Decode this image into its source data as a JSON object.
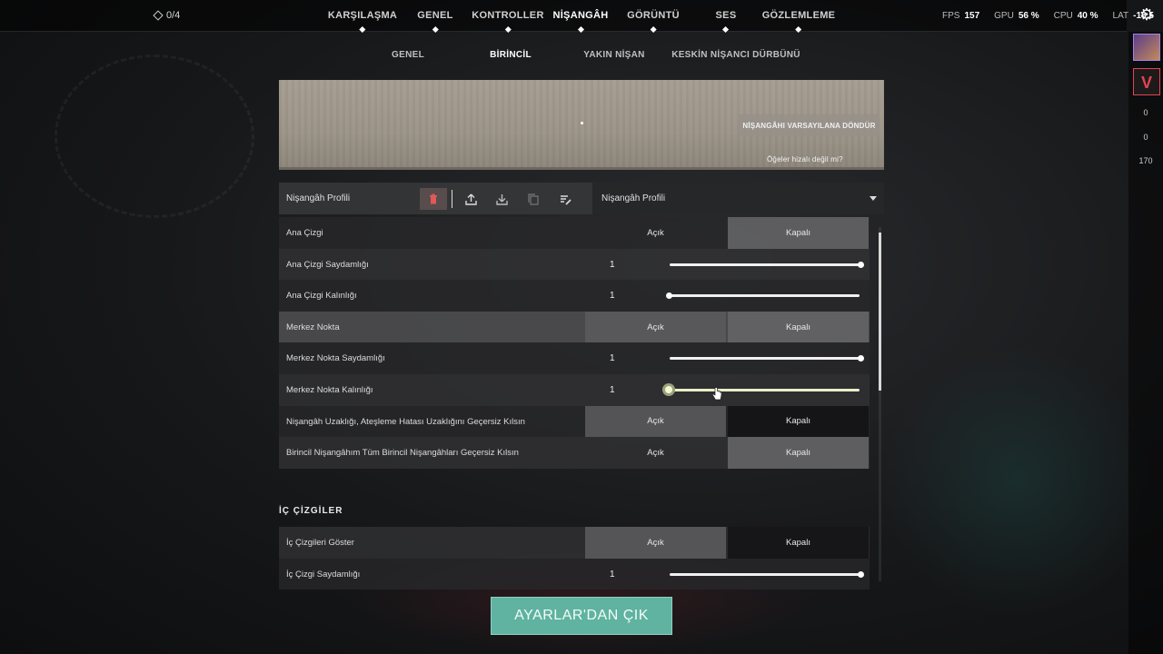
{
  "topbar": {
    "counter": "0/4",
    "tabs": [
      "KARŞILAŞMA",
      "GENEL",
      "KONTROLLER",
      "NİŞANGÂH",
      "GÖRÜNTÜ",
      "SES",
      "GÖZLEMLEME"
    ],
    "active_tab": "NİŞANGÂH",
    "perf": {
      "fps_label": "FPS",
      "fps": "157",
      "gpu_label": "GPU",
      "gpu": "56 %",
      "cpu_label": "CPU",
      "cpu": "40 %",
      "lat_label": "LAT",
      "lat": "-18.5"
    }
  },
  "rail": {
    "nums": [
      "0",
      "0",
      "170"
    ]
  },
  "subtabs": [
    "GENEL",
    "BİRİNCİL",
    "YAKIN NİŞAN",
    "KESKİN NİŞANCI DÜRBÜNÜ"
  ],
  "active_subtab": "BİRİNCİL",
  "preview": {
    "reset_label": "NİŞANGÂHI VARSAYILANA DÖNDÜR",
    "misaligned_label": "Öğeler hizalı değil mi?"
  },
  "profile": {
    "label": "Nişangâh Profili",
    "selected": "Nişangâh Profili"
  },
  "common": {
    "on": "Açık",
    "off": "Kapalı"
  },
  "rows": [
    {
      "label": "Ana Çizgi"
    },
    {
      "label": "Ana Çizgi Saydamlığı",
      "value": "1"
    },
    {
      "label": "Ana Çizgi Kalınlığı",
      "value": "1"
    },
    {
      "label": "Merkez Nokta"
    },
    {
      "label": "Merkez Nokta Saydamlığı",
      "value": "1"
    },
    {
      "label": "Merkez Nokta Kalınlığı",
      "value": "1"
    },
    {
      "label": "Nişangâh Uzaklığı, Ateşleme Hatası Uzaklığını Geçersiz Kılsın"
    },
    {
      "label": "Birincil Nişangâhım Tüm Birincil Nişangâhları Geçersiz Kılsın"
    }
  ],
  "section_inner": {
    "title": "İÇ ÇİZGİLER",
    "rows": [
      {
        "label": "İç Çizgileri Göster"
      },
      {
        "label": "İç Çizgi Saydamlığı",
        "value": "1"
      }
    ]
  },
  "exit_label": "AYARLAR'DAN ÇIK"
}
